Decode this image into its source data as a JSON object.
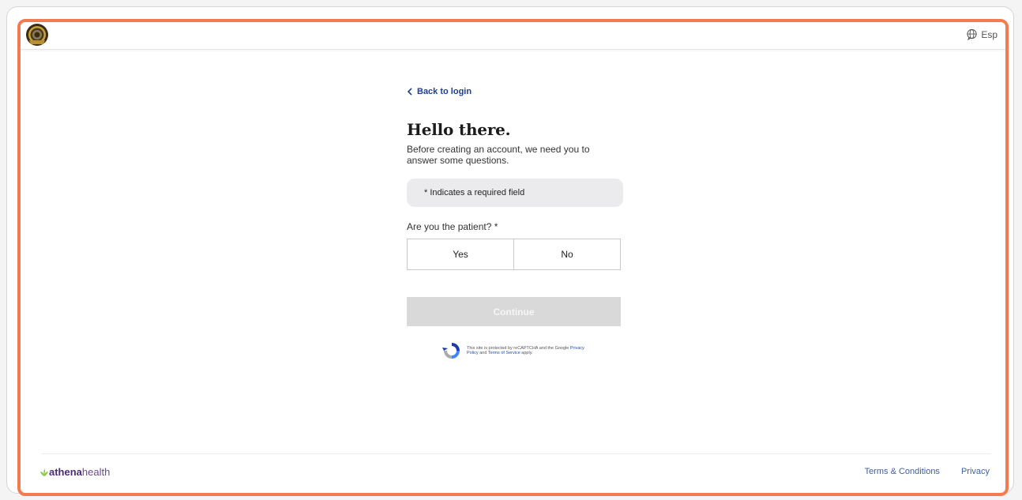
{
  "header": {
    "language_label": "Esp"
  },
  "main": {
    "back_label": "Back to login",
    "title": "Hello there.",
    "subtitle": "Before creating an account, we need you to answer some questions.",
    "required_note": "* Indicates a required field",
    "question": "Are you the patient? *",
    "options": [
      "Yes",
      "No"
    ],
    "continue_label": "Continue"
  },
  "recaptcha": {
    "text_before": "This site is protected by reCAPTCHA and the Google ",
    "privacy_link": "Privacy Policy",
    "and": " and ",
    "terms_link": "Terms of Service",
    "text_after": " apply."
  },
  "footer": {
    "brand_part1": "athena",
    "brand_part2": "health",
    "links": [
      "Terms & Conditions",
      "Privacy"
    ]
  },
  "colors": {
    "accent_border": "#f47b4f",
    "link_blue": "#1f3f8f",
    "continue_disabled": "#d9d9d9",
    "brand_purple": "#4c2c72",
    "brand_leaf": "#8dc63f"
  },
  "icons": {
    "logo": "seal-logo-icon",
    "language": "globe-chat-icon",
    "back": "chevron-left-icon",
    "recaptcha": "recaptcha-icon",
    "brand": "leaf-icon"
  }
}
